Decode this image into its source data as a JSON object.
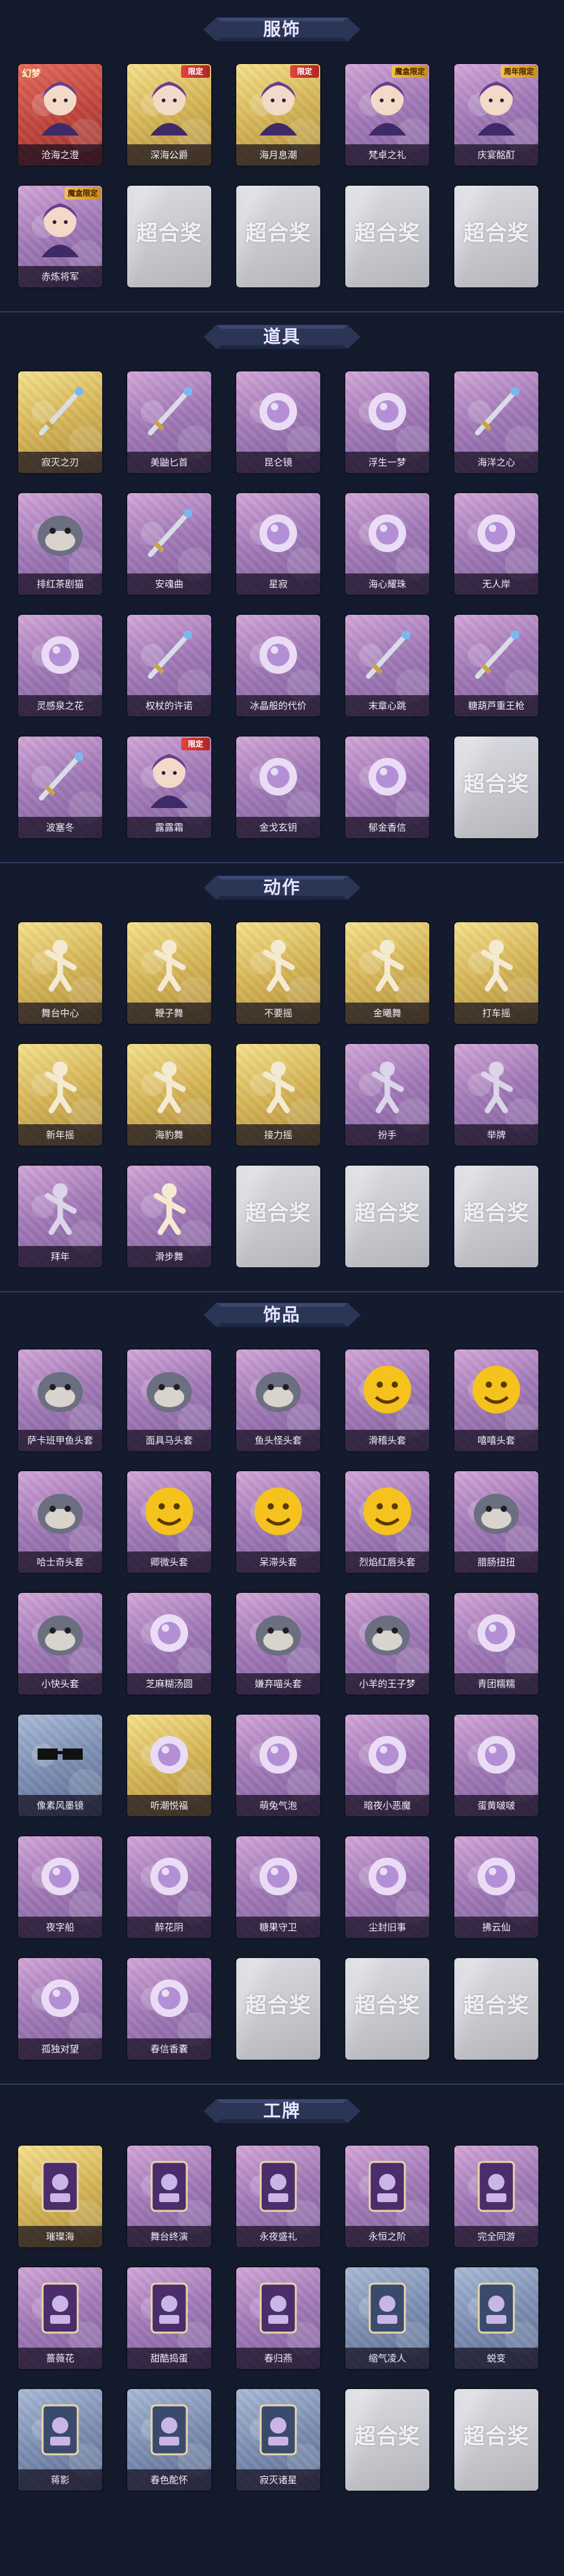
{
  "colors": {
    "background": "#131a2c",
    "banner": "#2b3556",
    "caption_bg": "#1a1226",
    "purple_card": "#a27ab8",
    "gold_card": "#d8b85a",
    "placeholder_card": "#c8c9cf"
  },
  "placeholder_logo": "超合奖",
  "sections": [
    {
      "title": "服饰",
      "items": [
        {
          "label": "沧海之澄",
          "rarity": "red",
          "icon": "character-portrait-icon",
          "corner": "幻梦"
        },
        {
          "label": "深海公爵",
          "rarity": "gold",
          "icon": "character-portrait-icon",
          "badge": "限定"
        },
        {
          "label": "海月息潮",
          "rarity": "gold",
          "icon": "character-portrait-icon",
          "badge": "限定"
        },
        {
          "label": "梵卓之礼",
          "rarity": "purple",
          "icon": "character-portrait-icon",
          "badge": "魔盒限定"
        },
        {
          "label": "庆宴酩酊",
          "rarity": "purple",
          "icon": "character-portrait-icon",
          "badge": "周年限定"
        },
        {
          "label": "赤炼将军",
          "rarity": "purple",
          "icon": "character-portrait-icon",
          "badge": "魔盒限定"
        },
        {
          "placeholder": true
        },
        {
          "placeholder": true
        },
        {
          "placeholder": true
        },
        {
          "placeholder": true
        }
      ]
    },
    {
      "title": "道具",
      "items": [
        {
          "label": "寂灭之刃",
          "rarity": "gold",
          "icon": "sword-icon"
        },
        {
          "label": "美鼬匕首",
          "rarity": "purple",
          "icon": "dagger-icon"
        },
        {
          "label": "昆仑镜",
          "rarity": "purple",
          "icon": "mirror-icon"
        },
        {
          "label": "浮生一梦",
          "rarity": "purple",
          "icon": "hourglass-icon"
        },
        {
          "label": "海洋之心",
          "rarity": "purple",
          "icon": "gem-staff-icon"
        },
        {
          "label": "排红茶剧猫",
          "rarity": "purple",
          "icon": "cat-mask-icon"
        },
        {
          "label": "安魂曲",
          "rarity": "purple",
          "icon": "sword-icon"
        },
        {
          "label": "星寂",
          "rarity": "purple",
          "icon": "telescope-icon"
        },
        {
          "label": "海心耀珠",
          "rarity": "purple",
          "icon": "pearl-shell-icon"
        },
        {
          "label": "无人岸",
          "rarity": "purple",
          "icon": "flower-vase-icon"
        },
        {
          "label": "灵感泉之花",
          "rarity": "purple",
          "icon": "flower-bouquet-icon"
        },
        {
          "label": "权杖的许诺",
          "rarity": "purple",
          "icon": "scepter-icon"
        },
        {
          "label": "冰晶般的代价",
          "rarity": "purple",
          "icon": "ice-lotus-icon"
        },
        {
          "label": "末章心跳",
          "rarity": "purple",
          "icon": "wand-icon"
        },
        {
          "label": "糖葫芦重王枪",
          "rarity": "purple",
          "icon": "candy-spear-icon"
        },
        {
          "label": "波塞冬",
          "rarity": "purple",
          "icon": "trident-icon"
        },
        {
          "label": "露露霜",
          "rarity": "purple",
          "icon": "character-portrait-icon",
          "badge": "限定"
        },
        {
          "label": "金戈玄钥",
          "rarity": "purple",
          "icon": "lantern-icon"
        },
        {
          "label": "郁金香信",
          "rarity": "purple",
          "icon": "scroll-icon"
        },
        {
          "placeholder": true
        }
      ]
    },
    {
      "title": "动作",
      "items": [
        {
          "label": "舞台中心",
          "rarity": "gold",
          "icon": "dance-pose-icon"
        },
        {
          "label": "鞭子舞",
          "rarity": "gold",
          "icon": "dance-pose-icon"
        },
        {
          "label": "不要摇",
          "rarity": "gold",
          "icon": "dance-pose-icon"
        },
        {
          "label": "金曦舞",
          "rarity": "gold",
          "icon": "dance-pose-icon"
        },
        {
          "label": "打车摇",
          "rarity": "gold",
          "icon": "dance-pose-icon"
        },
        {
          "label": "新年摇",
          "rarity": "gold",
          "icon": "dance-pose-icon"
        },
        {
          "label": "海豹舞",
          "rarity": "gold",
          "icon": "dance-pose-icon"
        },
        {
          "label": "接力摇",
          "rarity": "gold",
          "icon": "dance-pose-icon"
        },
        {
          "label": "扮手",
          "rarity": "purple",
          "icon": "pose-silhouette-icon"
        },
        {
          "label": "举牌",
          "rarity": "purple",
          "icon": "pose-silhouette-icon"
        },
        {
          "label": "拜年",
          "rarity": "purple",
          "icon": "pose-silhouette-icon"
        },
        {
          "label": "滑步舞",
          "rarity": "purple",
          "icon": "dance-pose-icon"
        },
        {
          "placeholder": true
        },
        {
          "placeholder": true
        },
        {
          "placeholder": true
        }
      ]
    },
    {
      "title": "饰品",
      "items": [
        {
          "label": "萨卡班甲鱼头套",
          "rarity": "purple",
          "icon": "fish-head-icon"
        },
        {
          "label": "面具马头套",
          "rarity": "purple",
          "icon": "horse-head-icon"
        },
        {
          "label": "鱼头怪头套",
          "rarity": "purple",
          "icon": "fish-monster-icon"
        },
        {
          "label": "滑稽头套",
          "rarity": "purple",
          "icon": "smiley-icon"
        },
        {
          "label": "嘻嘻头套",
          "rarity": "purple",
          "icon": "grin-icon"
        },
        {
          "label": "哈士奇头套",
          "rarity": "purple",
          "icon": "husky-head-icon"
        },
        {
          "label": "卿微头套",
          "rarity": "purple",
          "icon": "sad-face-icon"
        },
        {
          "label": "呆滞头套",
          "rarity": "purple",
          "icon": "dazed-face-icon"
        },
        {
          "label": "烈焰红唇头套",
          "rarity": "purple",
          "icon": "lips-face-icon"
        },
        {
          "label": "腊肠扭扭",
          "rarity": "purple",
          "icon": "dog-head-icon"
        },
        {
          "label": "小快头套",
          "rarity": "purple",
          "icon": "robot-head-icon"
        },
        {
          "label": "芝麻糊汤圆",
          "rarity": "purple",
          "icon": "dumpling-icon"
        },
        {
          "label": "嫌弃喵头套",
          "rarity": "purple",
          "icon": "cat-head-icon"
        },
        {
          "label": "小羊的王子梦",
          "rarity": "purple",
          "icon": "sheep-head-icon"
        },
        {
          "label": "青团糯糯",
          "rarity": "purple",
          "icon": "rice-ball-icon"
        },
        {
          "label": "像素风墨镜",
          "rarity": "blue",
          "icon": "sunglasses-icon"
        },
        {
          "label": "听潮悦福",
          "rarity": "gold",
          "icon": "crystal-ornament-icon"
        },
        {
          "label": "萌兔气泡",
          "rarity": "purple",
          "icon": "bubble-icon"
        },
        {
          "label": "暗夜小恶魔",
          "rarity": "purple",
          "icon": "devil-icon"
        },
        {
          "label": "蛋黄啵啵",
          "rarity": "purple",
          "icon": "egg-icon"
        },
        {
          "label": "夜字船",
          "rarity": "purple",
          "icon": "crystal-ornament-icon"
        },
        {
          "label": "醉花阴",
          "rarity": "purple",
          "icon": "flower-ornament-icon"
        },
        {
          "label": "糖果守卫",
          "rarity": "purple",
          "icon": "candy-ornament-icon"
        },
        {
          "label": "尘封旧事",
          "rarity": "purple",
          "icon": "figure-ornament-icon"
        },
        {
          "label": "拂云仙",
          "rarity": "purple",
          "icon": "fairy-ornament-icon"
        },
        {
          "label": "孤独对望",
          "rarity": "purple",
          "icon": "crystal-ornament-icon"
        },
        {
          "label": "春信香囊",
          "rarity": "purple",
          "icon": "sachet-icon"
        },
        {
          "placeholder": true
        },
        {
          "placeholder": true
        },
        {
          "placeholder": true
        }
      ]
    },
    {
      "title": "工牌",
      "items": [
        {
          "label": "璀璨海",
          "rarity": "gold",
          "icon": "badge-card-icon"
        },
        {
          "label": "舞台终演",
          "rarity": "purple",
          "icon": "badge-card-icon"
        },
        {
          "label": "永夜盛礼",
          "rarity": "purple",
          "icon": "badge-card-icon"
        },
        {
          "label": "永恒之阶",
          "rarity": "purple",
          "icon": "badge-card-icon"
        },
        {
          "label": "完全同游",
          "rarity": "purple",
          "icon": "badge-card-icon"
        },
        {
          "label": "蔷薇花",
          "rarity": "purple",
          "icon": "badge-card-icon"
        },
        {
          "label": "甜酷捣蛋",
          "rarity": "purple",
          "icon": "badge-card-icon"
        },
        {
          "label": "春归燕",
          "rarity": "purple",
          "icon": "badge-card-icon"
        },
        {
          "label": "缩气凌人",
          "rarity": "blue",
          "icon": "badge-silhouette-icon"
        },
        {
          "label": "蜕变",
          "rarity": "blue",
          "icon": "badge-silhouette-icon"
        },
        {
          "label": "蒋影",
          "rarity": "blue",
          "icon": "badge-silhouette-icon"
        },
        {
          "label": "春色酡怀",
          "rarity": "blue",
          "icon": "badge-silhouette-icon"
        },
        {
          "label": "寂灭诸星",
          "rarity": "blue",
          "icon": "badge-silhouette-icon"
        },
        {
          "placeholder": true
        },
        {
          "placeholder": true
        }
      ]
    }
  ]
}
